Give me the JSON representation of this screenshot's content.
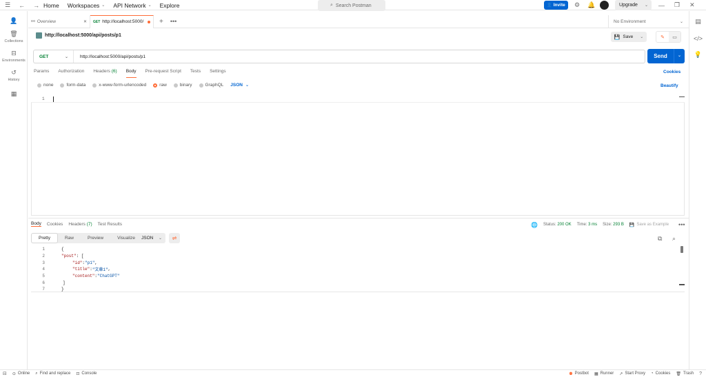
{
  "topbar": {
    "nav": [
      "Home",
      "Workspaces",
      "API Network",
      "Explore"
    ],
    "search_placeholder": "Search Postman",
    "invite": "Invite",
    "upgrade": "Upgrade"
  },
  "sidebar": {
    "items": [
      {
        "label": ""
      },
      {
        "label": "Collections"
      },
      {
        "label": "Environments"
      },
      {
        "label": "History"
      },
      {
        "label": ""
      }
    ]
  },
  "tabs": [
    {
      "label": "Overview"
    },
    {
      "method": "GET",
      "label": "http://localhost:5000/"
    }
  ],
  "environment": "No Environment",
  "request": {
    "title": "http://localhost:5000/api/posts/p1",
    "method": "GET",
    "url": "http://localhost:5000/api/posts/p1",
    "save": "Save",
    "send": "Send",
    "subtabs": [
      {
        "label": "Params"
      },
      {
        "label": "Authorization"
      },
      {
        "label": "Headers",
        "count": "(6)"
      },
      {
        "label": "Body"
      },
      {
        "label": "Pre-request Script"
      },
      {
        "label": "Tests"
      },
      {
        "label": "Settings"
      }
    ],
    "cookies": "Cookies",
    "body_options": [
      "none",
      "form-data",
      "x-www-form-urlencoded",
      "raw",
      "binary",
      "GraphQL"
    ],
    "body_format": "JSON",
    "beautify": "Beautify",
    "editor_line": "1"
  },
  "response": {
    "tabs": [
      {
        "label": "Body"
      },
      {
        "label": "Cookies"
      },
      {
        "label": "Headers",
        "count": "(7)"
      },
      {
        "label": "Test Results"
      }
    ],
    "status_label": "Status:",
    "status": "200 OK",
    "time_label": "Time:",
    "time": "3 ms",
    "size_label": "Size:",
    "size": "293 B",
    "save_example": "Save as Example",
    "view_tabs": [
      "Pretty",
      "Raw",
      "Preview",
      "Visualize"
    ],
    "format": "JSON",
    "lines": [
      {
        "n": "1",
        "text": "{"
      },
      {
        "n": "2",
        "key": "\"post\"",
        "rest": ": ["
      },
      {
        "n": "3",
        "key": "\"id\"",
        "rest": ": ",
        "val": "\"p1\"",
        "tail": ","
      },
      {
        "n": "4",
        "key": "\"title\"",
        "rest": ": ",
        "val": "\"文章1\"",
        "tail": ","
      },
      {
        "n": "5",
        "key": "\"content\"",
        "rest": ": ",
        "val": "\"ChatGPT\"",
        "tail": ""
      },
      {
        "n": "6",
        "text": "]"
      },
      {
        "n": "7",
        "text": "}"
      }
    ]
  },
  "statusbar": {
    "left": [
      "Online",
      "Find and replace",
      "Console"
    ],
    "right": [
      "Postbot",
      "Runner",
      "Start Proxy",
      "Cookies",
      "Trash"
    ]
  }
}
